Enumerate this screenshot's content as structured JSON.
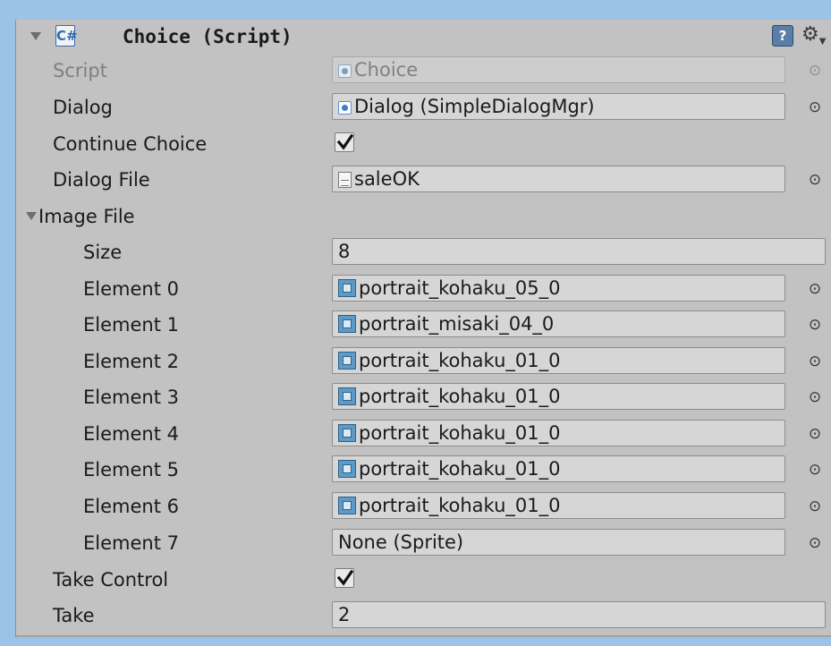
{
  "component": {
    "title": "Choice (Script)",
    "icon_glyph": "C#",
    "help_glyph": "?",
    "settings_glyph": "⚙"
  },
  "fields": {
    "script": {
      "label": "Script",
      "value": "Choice"
    },
    "dialog": {
      "label": "Dialog",
      "value": "Dialog (SimpleDialogMgr)"
    },
    "continue_choice": {
      "label": "Continue Choice",
      "checked": true
    },
    "dialog_file": {
      "label": "Dialog File",
      "value": "saleOK"
    },
    "image_file": {
      "label": "Image File",
      "size_label": "Size",
      "size_value": "8",
      "elements": [
        {
          "label": "Element 0",
          "value": "portrait_kohaku_05_0"
        },
        {
          "label": "Element 1",
          "value": "portrait_misaki_04_0"
        },
        {
          "label": "Element 2",
          "value": "portrait_kohaku_01_0"
        },
        {
          "label": "Element 3",
          "value": "portrait_kohaku_01_0"
        },
        {
          "label": "Element 4",
          "value": "portrait_kohaku_01_0"
        },
        {
          "label": "Element 5",
          "value": "portrait_kohaku_01_0"
        },
        {
          "label": "Element 6",
          "value": "portrait_kohaku_01_0"
        },
        {
          "label": "Element 7",
          "value": "None (Sprite)"
        }
      ]
    },
    "take_control": {
      "label": "Take Control",
      "checked": true
    },
    "take": {
      "label": "Take",
      "value": "2"
    }
  },
  "picker_glyph": "⊙",
  "colors": {
    "background": "#9cc3e6",
    "panel": "#c2c2c2",
    "field": "#d6d6d6",
    "accent": "#3f7fc8"
  }
}
